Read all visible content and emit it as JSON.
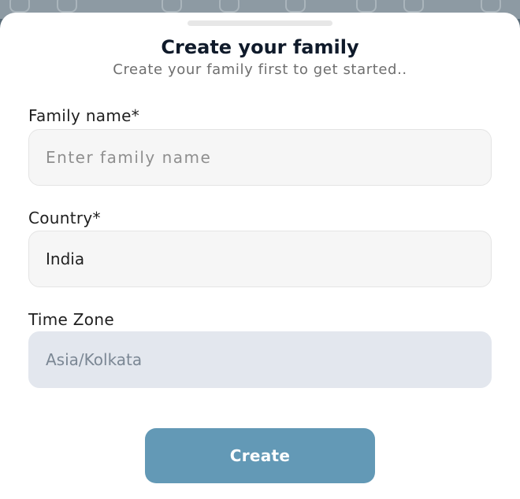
{
  "sheet": {
    "title": "Create your family",
    "subtitle": "Create your family first to get started.."
  },
  "form": {
    "family_name": {
      "label": "Family name*",
      "placeholder": "Enter family name",
      "value": ""
    },
    "country": {
      "label": "Country*",
      "value": "India"
    },
    "time_zone": {
      "label": "Time Zone",
      "value": "Asia/Kolkata"
    }
  },
  "actions": {
    "create_label": "Create"
  },
  "colors": {
    "primary_button": "#6399b6",
    "field_background": "#f6f6f6",
    "disabled_field_background": "#e3e7ee",
    "title_text": "#0f1a2a"
  },
  "icons": [
    "decorative-background-icon"
  ]
}
